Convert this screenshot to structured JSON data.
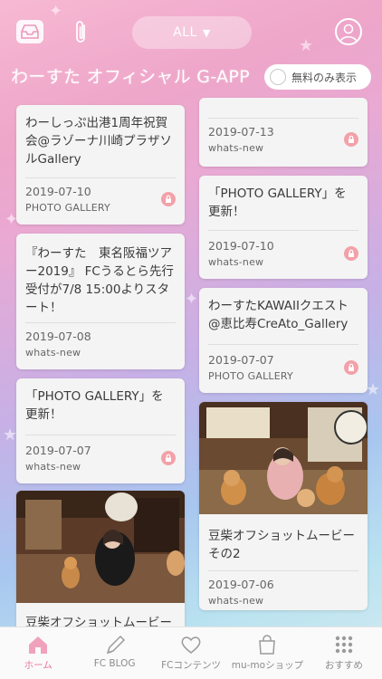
{
  "header": {
    "filter_label": "ALL",
    "app_title": "わーすた オフィシャル G-APP",
    "free_only_label": "無料のみ表示"
  },
  "left_column": [
    {
      "title": "わーしっぷ出港1周年祝賀会@ラゾーナ川崎プラザソルGallery",
      "date": "2019-07-10",
      "category": "PHOTO GALLERY",
      "locked": true
    },
    {
      "title": "『わーすた　東名阪福ツアー2019』 FCうるとら先行受付が7/8 15:00よりスタート！",
      "date": "2019-07-08",
      "category": "whats-new",
      "locked": false
    },
    {
      "title": "「PHOTO GALLERY」を更新！",
      "date": "2019-07-07",
      "category": "whats-new",
      "locked": true
    },
    {
      "title": "豆柴オフショットムービー",
      "date": "",
      "category": "",
      "locked": false,
      "has_image": true
    }
  ],
  "right_column": [
    {
      "title": "",
      "date": "2019-07-13",
      "category": "whats-new",
      "locked": true
    },
    {
      "title": "「PHOTO GALLERY」を更新！",
      "date": "2019-07-10",
      "category": "whats-new",
      "locked": true
    },
    {
      "title": "わーすたKAWAIIクエスト@恵比寿CreAto_Gallery",
      "date": "2019-07-07",
      "category": "PHOTO GALLERY",
      "locked": true
    },
    {
      "title": "豆柴オフショットムービーその2",
      "date": "2019-07-06",
      "category": "whats-new",
      "locked": false,
      "has_image": true
    }
  ],
  "tabbar": [
    {
      "label": "ホーム",
      "icon": "home-icon",
      "active": true
    },
    {
      "label": "FC BLOG",
      "icon": "pen-icon",
      "active": false
    },
    {
      "label": "FCコンテンツ",
      "icon": "heart-icon",
      "active": false
    },
    {
      "label": "mu-moショップ",
      "icon": "shopping-bag-icon",
      "active": false
    },
    {
      "label": "おすすめ",
      "icon": "grid-icon",
      "active": false
    }
  ],
  "colors": {
    "accent": "#e8779a",
    "lock": "#f3a1a9",
    "card_bg": "#f4f4f4"
  }
}
